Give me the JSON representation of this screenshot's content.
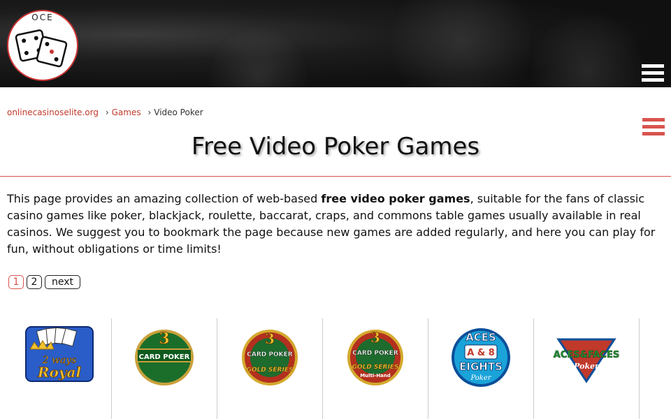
{
  "header": {
    "logo_text": "OCE",
    "menu_icon": "hamburger-icon"
  },
  "breadcrumb": {
    "home": "onlinecasinoselite.org",
    "sep1": "›",
    "games": "Games",
    "sep2": "›",
    "current": "Video Poker"
  },
  "page": {
    "title": "Free Video Poker Games",
    "intro_before": "This page provides an amazing collection of web-based ",
    "intro_bold": "free video poker games",
    "intro_after": ", suitable for the fans of classic casino games like poker, blackjack, roulette, baccarat, craps, and commons table games usually available in real casinos. We suggest you to bookmark the page because new games are added regularly, and here you can play for fun, without obligations or time limits!"
  },
  "pagination": {
    "pages": [
      "1",
      "2"
    ],
    "active": "1",
    "next_label": "next"
  },
  "games": [
    {
      "line1": "2 ways",
      "line2": "Royal"
    },
    {
      "line1": "3",
      "line2": "CARD POKER"
    },
    {
      "line1": "3",
      "line2": "CARD POKER",
      "line3": "GOLD SERIES"
    },
    {
      "line1": "3",
      "line2": "CARD POKER",
      "line3": "GOLD SERIES",
      "line4": "Multi-Hand"
    },
    {
      "line1": "ACES",
      "line2": "A & 8",
      "line3": "EIGHTS",
      "line4": "Poker"
    },
    {
      "line1": "ACES&FACES",
      "line2": "Poker"
    }
  ],
  "colors": {
    "accent": "#d9534f",
    "link": "#c0392b",
    "header_bg": "#141414"
  }
}
